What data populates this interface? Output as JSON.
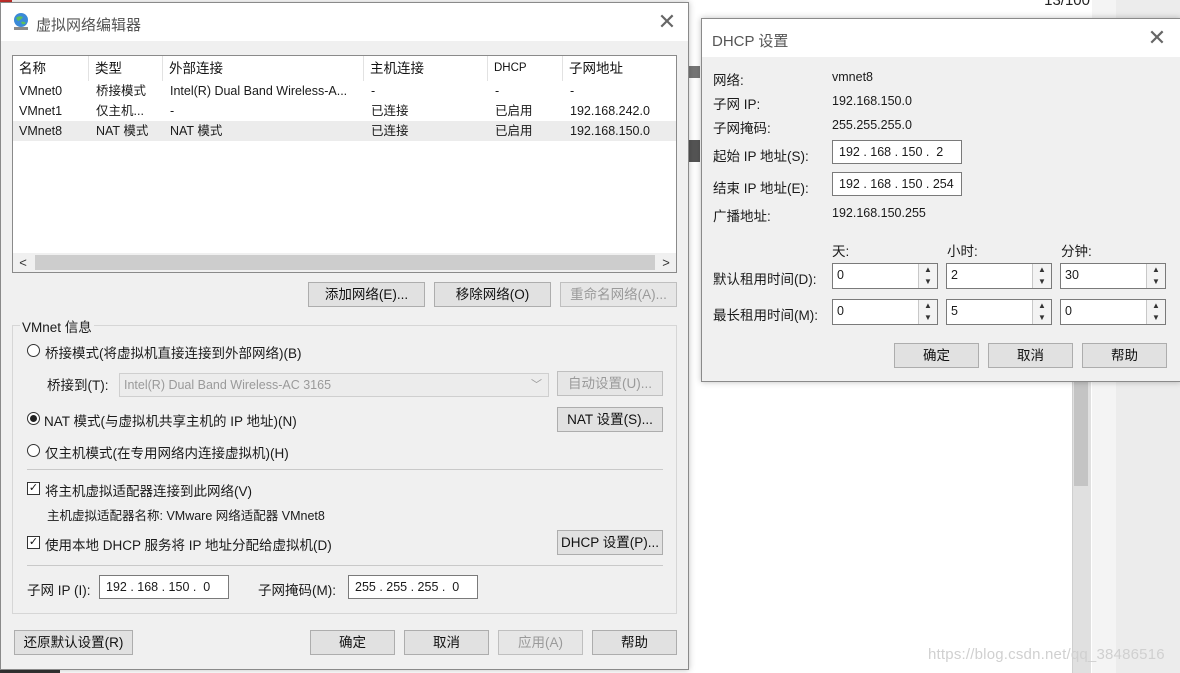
{
  "background": {
    "page_count": "13/100",
    "watermark": "https://blog.csdn.net/qq_38486516"
  },
  "vne": {
    "title": "虚拟网络编辑器",
    "table": {
      "headers": [
        "名称",
        "类型",
        "外部连接",
        "主机连接",
        "DHCP",
        "子网地址"
      ],
      "rows": [
        {
          "name": "VMnet0",
          "type": "桥接模式",
          "ext": "Intel(R) Dual Band Wireless-A...",
          "host": "-",
          "dhcp": "-",
          "subnet": "-"
        },
        {
          "name": "VMnet1",
          "type": "仅主机...",
          "ext": "-",
          "host": "已连接",
          "dhcp": "已启用",
          "subnet": "192.168.242.0"
        },
        {
          "name": "VMnet8",
          "type": "NAT 模式",
          "ext": "NAT 模式",
          "host": "已连接",
          "dhcp": "已启用",
          "subnet": "192.168.150.0"
        }
      ]
    },
    "buttons": {
      "add": "添加网络(E)...",
      "remove": "移除网络(O)",
      "rename": "重命名网络(A)..."
    },
    "info": {
      "group_title": "VMnet 信息",
      "bridge_mode": "桥接模式(将虚拟机直接连接到外部网络)(B)",
      "bridge_to": "桥接到(T):",
      "bridge_adapter": "Intel(R) Dual Band Wireless-AC 3165",
      "auto_settings": "自动设置(U)...",
      "nat_mode": "NAT 模式(与虚拟机共享主机的 IP 地址)(N)",
      "nat_settings": "NAT 设置(S)...",
      "host_only": "仅主机模式(在专用网络内连接虚拟机)(H)",
      "connect_adapter": "将主机虚拟适配器连接到此网络(V)",
      "adapter_name": "主机虚拟适配器名称: VMware 网络适配器 VMnet8",
      "use_dhcp": "使用本地 DHCP 服务将 IP 地址分配给虚拟机(D)",
      "dhcp_settings": "DHCP 设置(P)...",
      "subnet_ip_label": "子网 IP (I):",
      "subnet_ip": "192 . 168 . 150 .  0",
      "subnet_mask_label": "子网掩码(M):",
      "subnet_mask": "255 . 255 . 255 .  0"
    },
    "footer": {
      "restore": "还原默认设置(R)",
      "ok": "确定",
      "cancel": "取消",
      "apply": "应用(A)",
      "help": "帮助"
    }
  },
  "dhcp": {
    "title": "DHCP 设置",
    "network_label": "网络:",
    "network": "vmnet8",
    "subnet_ip_label": "子网 IP:",
    "subnet_ip": "192.168.150.0",
    "mask_label": "子网掩码:",
    "mask": "255.255.255.0",
    "start_label": "起始 IP 地址(S):",
    "start_ip": "192 . 168 . 150 .  2",
    "end_label": "结束 IP 地址(E):",
    "end_ip": "192 . 168 . 150 . 254",
    "broadcast_label": "广播地址:",
    "broadcast": "192.168.150.255",
    "col_days": "天:",
    "col_hours": "小时:",
    "col_minutes": "分钟:",
    "default_lease_label": "默认租用时间(D):",
    "default_lease": {
      "days": "0",
      "hours": "2",
      "minutes": "30"
    },
    "max_lease_label": "最长租用时间(M):",
    "max_lease": {
      "days": "0",
      "hours": "5",
      "minutes": "0"
    },
    "ok": "确定",
    "cancel": "取消",
    "help": "帮助"
  }
}
